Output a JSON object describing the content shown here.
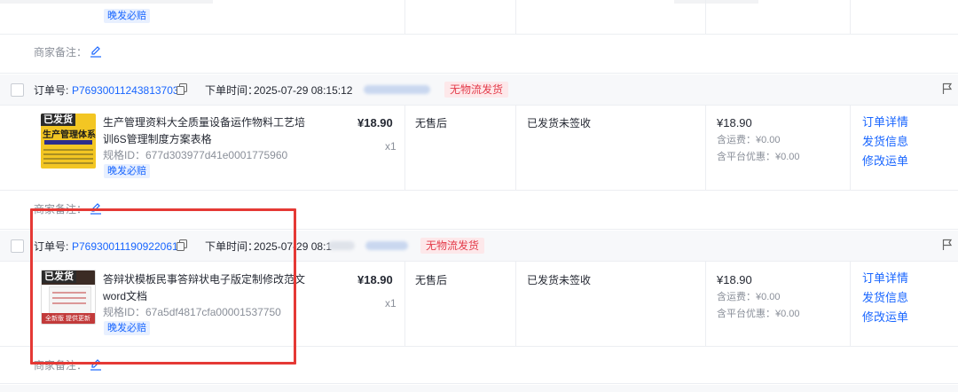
{
  "top_partial": {
    "tag": "晚发必赔",
    "note_label": "商家备注："
  },
  "orders": [
    {
      "order_label": "订单号:",
      "order_no": "P769300112438137031",
      "time_label": "下单时间：",
      "time": "2025-07-29 08:15:12",
      "logistics_tag": "无物流发货",
      "thumb_badge": "已发货",
      "thumb_title": "生产管理体系",
      "title_line1": "生产管理资料大全质量设备运作物料工艺培",
      "title_line2": "训6S管理制度方案表格",
      "sku": "规格ID：677d303977d41e0001775960",
      "tag": "晚发必赔",
      "price": "¥18.90",
      "qty": "x1",
      "after_sale": "无售后",
      "status": "已发货未签收",
      "total": "¥18.90",
      "shipping": "含运费：¥0.00",
      "discount": "含平台优惠：¥0.00",
      "actions": [
        "订单详情",
        "发货信息",
        "修改运单"
      ],
      "note_label": "商家备注："
    },
    {
      "order_label": "订单号:",
      "order_no": "P769300111909220611",
      "time_label": "下单时间：",
      "time": "2025-07-29 08:1",
      "logistics_tag": "无物流发货",
      "thumb_badge": "已发货",
      "thumb_bottom": "全新版 提供更新",
      "title_line1": "答辩状模板民事答辩状电子版定制修改范文",
      "title_line2": "word文档",
      "sku": "规格ID：67a5df4817cfa00001537750",
      "tag": "晚发必赔",
      "price": "¥18.90",
      "qty": "x1",
      "after_sale": "无售后",
      "status": "已发货未签收",
      "total": "¥18.90",
      "shipping": "含运费：¥0.00",
      "discount": "含平台优惠：¥0.00",
      "actions": [
        "订单详情",
        "发货信息",
        "修改运单"
      ],
      "note_label": "商家备注："
    }
  ],
  "icons": {
    "copy": "copy-icon",
    "edit": "edit-icon",
    "flag": "flag-icon"
  },
  "colors": {
    "link": "#1966ff",
    "tag_blue_bg": "#e8f0ff",
    "tag_red": "#e33b4a",
    "tag_red_bg": "#fde8ea",
    "highlight": "#e53935"
  }
}
